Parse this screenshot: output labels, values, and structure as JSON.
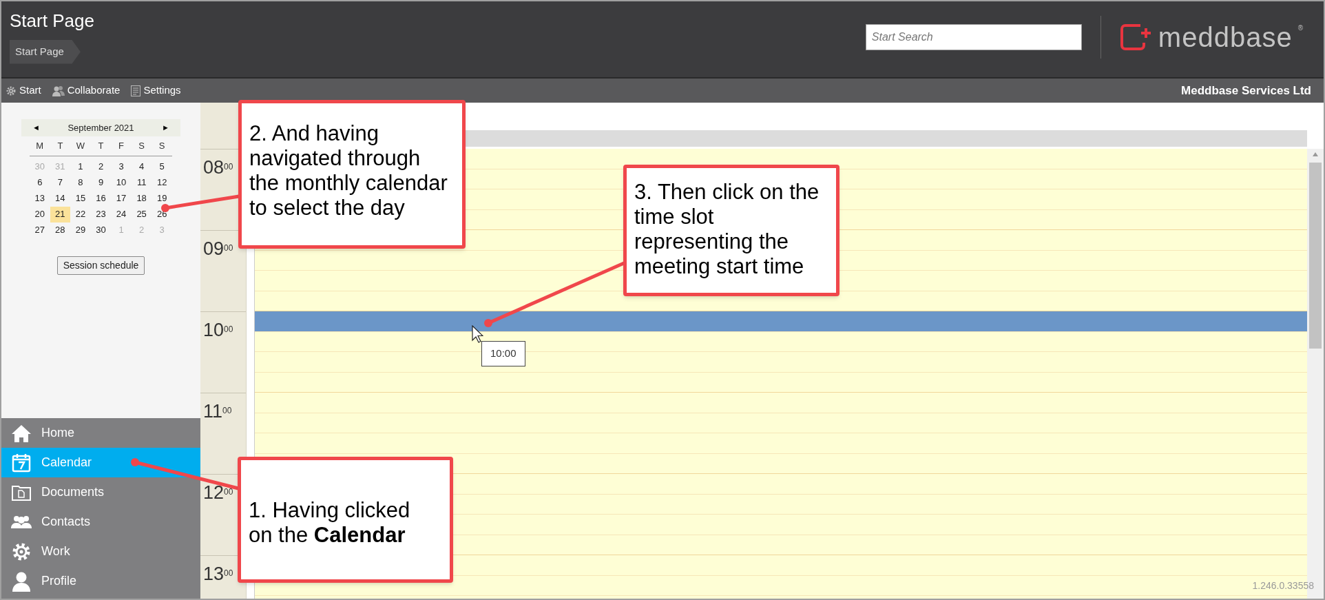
{
  "header": {
    "title": "Start Page",
    "breadcrumb": "Start Page",
    "search": {
      "placeholder": "Start Search"
    },
    "logo": {
      "text": "meddbase",
      "mark": "®"
    }
  },
  "toolbar": {
    "items": [
      {
        "label": "Start",
        "kind": "gear"
      },
      {
        "label": "Collaborate",
        "kind": "people"
      },
      {
        "label": "Settings",
        "kind": "sheet"
      }
    ],
    "company": "Meddbase Services Ltd"
  },
  "calendar": {
    "month": "September 2021",
    "prev": "◄",
    "next": "►",
    "weekdays": [
      "M",
      "T",
      "W",
      "T",
      "F",
      "S",
      "S"
    ],
    "weeks": [
      [
        {
          "day": "30",
          "kind": "other",
          "selected": false
        },
        {
          "day": "31",
          "kind": "other",
          "selected": false
        },
        {
          "day": "1",
          "kind": "current",
          "selected": false
        },
        {
          "day": "2",
          "kind": "current",
          "selected": false
        },
        {
          "day": "3",
          "kind": "current",
          "selected": false
        },
        {
          "day": "4",
          "kind": "current",
          "selected": false
        },
        {
          "day": "5",
          "kind": "current",
          "selected": false
        }
      ],
      [
        {
          "day": "6",
          "kind": "current",
          "selected": false
        },
        {
          "day": "7",
          "kind": "current",
          "selected": false
        },
        {
          "day": "8",
          "kind": "current",
          "selected": false
        },
        {
          "day": "9",
          "kind": "current",
          "selected": false
        },
        {
          "day": "10",
          "kind": "current",
          "selected": false
        },
        {
          "day": "11",
          "kind": "current",
          "selected": false
        },
        {
          "day": "12",
          "kind": "current",
          "selected": false
        }
      ],
      [
        {
          "day": "13",
          "kind": "current",
          "selected": false
        },
        {
          "day": "14",
          "kind": "current",
          "selected": false
        },
        {
          "day": "15",
          "kind": "current",
          "selected": false
        },
        {
          "day": "16",
          "kind": "current",
          "selected": false
        },
        {
          "day": "17",
          "kind": "current",
          "selected": false
        },
        {
          "day": "18",
          "kind": "current",
          "selected": false
        },
        {
          "day": "19",
          "kind": "current",
          "selected": false
        }
      ],
      [
        {
          "day": "20",
          "kind": "current",
          "selected": false
        },
        {
          "day": "21",
          "kind": "current",
          "selected": true
        },
        {
          "day": "22",
          "kind": "current",
          "selected": false
        },
        {
          "day": "23",
          "kind": "current",
          "selected": false
        },
        {
          "day": "24",
          "kind": "current",
          "selected": false
        },
        {
          "day": "25",
          "kind": "current",
          "selected": false
        },
        {
          "day": "26",
          "kind": "current",
          "selected": false
        }
      ],
      [
        {
          "day": "27",
          "kind": "current",
          "selected": false
        },
        {
          "day": "28",
          "kind": "current",
          "selected": false
        },
        {
          "day": "29",
          "kind": "current",
          "selected": false
        },
        {
          "day": "30",
          "kind": "current",
          "selected": false
        },
        {
          "day": "1",
          "kind": "other",
          "selected": false
        },
        {
          "day": "2",
          "kind": "other",
          "selected": false
        },
        {
          "day": "3",
          "kind": "other",
          "selected": false
        }
      ]
    ],
    "button": "Session schedule"
  },
  "nav": {
    "items": [
      {
        "label": "Home",
        "kind": "home",
        "selected": false
      },
      {
        "label": "Calendar",
        "kind": "calendar",
        "selected": true
      },
      {
        "label": "Documents",
        "kind": "folder",
        "selected": false
      },
      {
        "label": "Contacts",
        "kind": "people",
        "selected": false
      },
      {
        "label": "Work",
        "kind": "gear",
        "selected": false
      },
      {
        "label": "Profile",
        "kind": "person",
        "selected": false
      }
    ]
  },
  "schedule": {
    "hours": [
      {
        "label": "08$^{00}$",
        "slots": [
          {
            "selected": false
          },
          {
            "selected": false
          },
          {
            "selected": false
          },
          {
            "selected": false
          }
        ]
      },
      {
        "label": "09$^{00}$",
        "slots": [
          {
            "selected": false
          },
          {
            "selected": false
          },
          {
            "selected": false
          },
          {
            "selected": false
          }
        ]
      },
      {
        "label": "10$^{00}$",
        "slots": [
          {
            "selected": true
          },
          {
            "selected": false
          },
          {
            "selected": false
          },
          {
            "selected": false
          }
        ]
      },
      {
        "label": "11$^{00}$",
        "slots": [
          {
            "selected": false
          },
          {
            "selected": false
          },
          {
            "selected": false
          },
          {
            "selected": false
          }
        ]
      },
      {
        "label": "12$^{00}$",
        "slots": [
          {
            "selected": false
          },
          {
            "selected": false
          },
          {
            "selected": false
          },
          {
            "selected": false
          }
        ]
      },
      {
        "label": "13$^{00}$",
        "slots": [
          {
            "selected": false
          },
          {
            "selected": false
          }
        ]
      }
    ],
    "tooltip": "10:00",
    "version": "1.246.0.33558"
  },
  "callouts": [
    {
      "text": "2. And having\nnavigated through\nthe monthly calendar\nto select the day"
    },
    {
      "text": "3. Then click on the\ntime slot\nrepresenting the\nmeeting start time"
    },
    {
      "text": "1. Having clicked\non the **Calendar**"
    }
  ]
}
